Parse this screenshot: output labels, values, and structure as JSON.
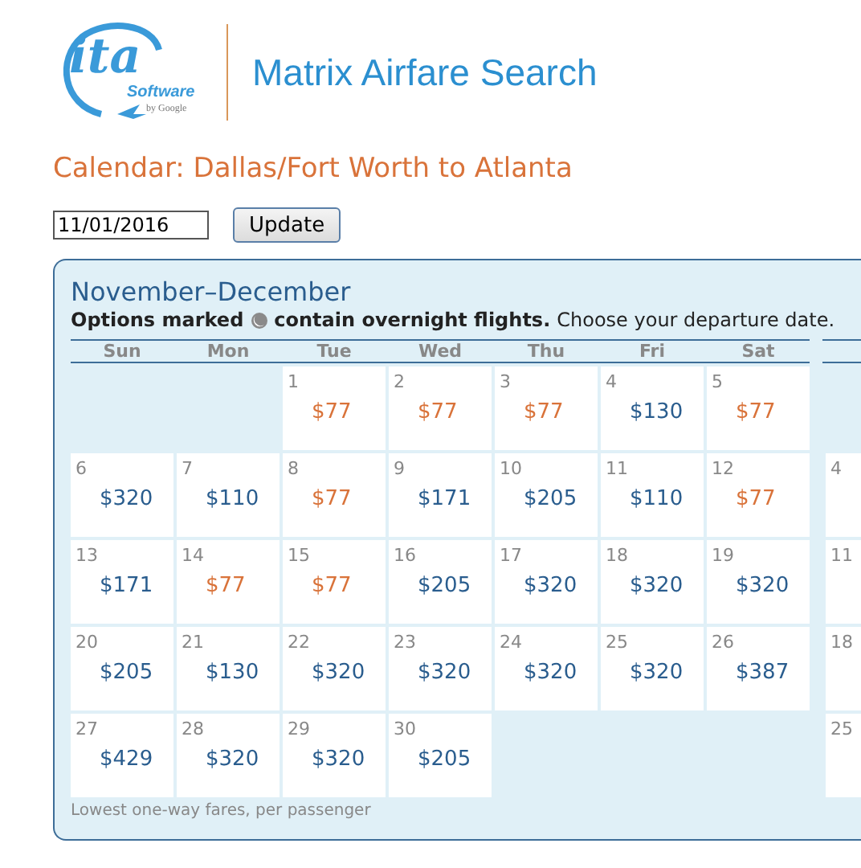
{
  "logo": {
    "mark": "ita",
    "software": "Software",
    "by": "by Google"
  },
  "app_title": "Matrix Airfare Search",
  "page_title": "Calendar: Dallas/Fort Worth to Atlanta",
  "date_field": {
    "value": "11/01/2016"
  },
  "update_button": "Update",
  "calendar": {
    "title": "November–December",
    "note_bold_start": "Options marked",
    "note_bold_end": "contain overnight flights.",
    "note_rest": "Choose your departure date.",
    "weekdays": [
      "Sun",
      "Mon",
      "Tue",
      "Wed",
      "Thu",
      "Fri",
      "Sat"
    ],
    "weeks": [
      [
        {
          "kind": "empty"
        },
        {
          "kind": "empty"
        },
        {
          "day": "1",
          "fare": "$77",
          "low": true
        },
        {
          "day": "2",
          "fare": "$77",
          "low": true
        },
        {
          "day": "3",
          "fare": "$77",
          "low": true
        },
        {
          "day": "4",
          "fare": "$130",
          "low": false
        },
        {
          "day": "5",
          "fare": "$77",
          "low": true
        }
      ],
      [
        {
          "day": "6",
          "fare": "$320",
          "low": false
        },
        {
          "day": "7",
          "fare": "$110",
          "low": false
        },
        {
          "day": "8",
          "fare": "$77",
          "low": true
        },
        {
          "day": "9",
          "fare": "$171",
          "low": false
        },
        {
          "day": "10",
          "fare": "$205",
          "low": false
        },
        {
          "day": "11",
          "fare": "$110",
          "low": false
        },
        {
          "day": "12",
          "fare": "$77",
          "low": true
        }
      ],
      [
        {
          "day": "13",
          "fare": "$171",
          "low": false
        },
        {
          "day": "14",
          "fare": "$77",
          "low": true
        },
        {
          "day": "15",
          "fare": "$77",
          "low": true
        },
        {
          "day": "16",
          "fare": "$205",
          "low": false
        },
        {
          "day": "17",
          "fare": "$320",
          "low": false
        },
        {
          "day": "18",
          "fare": "$320",
          "low": false
        },
        {
          "day": "19",
          "fare": "$320",
          "low": false
        }
      ],
      [
        {
          "day": "20",
          "fare": "$205",
          "low": false
        },
        {
          "day": "21",
          "fare": "$130",
          "low": false
        },
        {
          "day": "22",
          "fare": "$320",
          "low": false
        },
        {
          "day": "23",
          "fare": "$320",
          "low": false
        },
        {
          "day": "24",
          "fare": "$320",
          "low": false
        },
        {
          "day": "25",
          "fare": "$320",
          "low": false
        },
        {
          "day": "26",
          "fare": "$387",
          "low": false
        }
      ],
      [
        {
          "day": "27",
          "fare": "$429",
          "low": false
        },
        {
          "day": "28",
          "fare": "$320",
          "low": false
        },
        {
          "day": "29",
          "fare": "$320",
          "low": false
        },
        {
          "day": "30",
          "fare": "$205",
          "low": false
        },
        {
          "kind": "empty"
        },
        {
          "kind": "empty"
        },
        {
          "kind": "empty"
        }
      ]
    ],
    "next_month_days": [
      {
        "kind": "empty"
      },
      {
        "kind": "day",
        "day": "4"
      },
      {
        "kind": "day",
        "day": "11"
      },
      {
        "kind": "day",
        "day": "18"
      },
      {
        "kind": "day",
        "day": "25"
      }
    ],
    "footnote": "Lowest one-way fares, per passenger"
  }
}
